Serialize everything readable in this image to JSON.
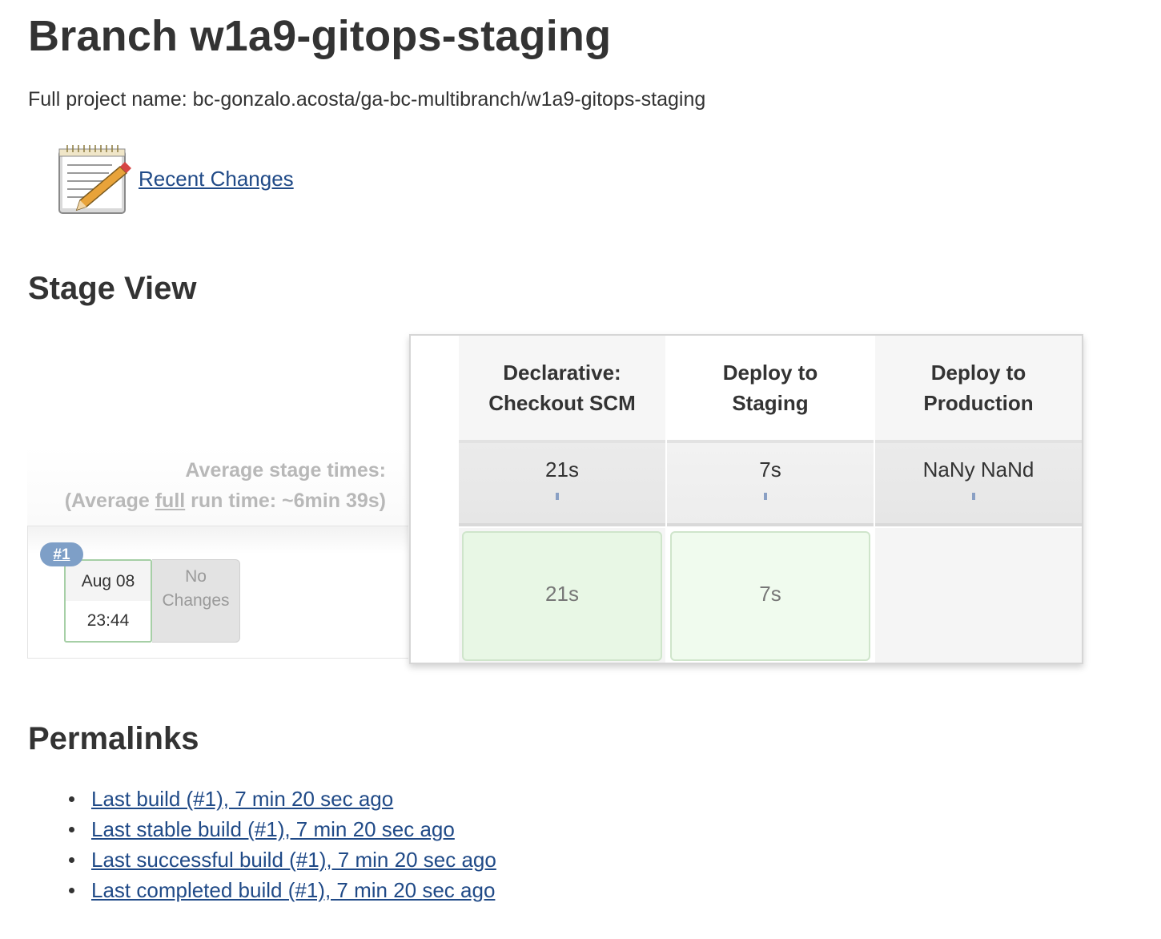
{
  "page": {
    "title": "Branch w1a9-gitops-staging",
    "full_project_name": "Full project name: bc-gonzalo.acosta/ga-bc-multibranch/w1a9-gitops-staging"
  },
  "recent_changes": {
    "label": "Recent Changes",
    "icon": "notepad-pencil-icon"
  },
  "stage_view": {
    "heading": "Stage View",
    "average_label_line1": "Average stage times:",
    "average_label_prefix": "(Average ",
    "average_label_full": "full",
    "average_label_suffix": " run time: ~6min 39s)",
    "stages": [
      {
        "name_line1": "Declarative:",
        "name_line2": "Checkout SCM",
        "average": "21s",
        "run_time": "21s",
        "status": "success"
      },
      {
        "name_line1": "Deploy to",
        "name_line2": "Staging",
        "average": "7s",
        "run_time": "7s",
        "status": "success"
      },
      {
        "name_line1": "Deploy to",
        "name_line2": "Production",
        "average": "NaNy NaNd",
        "run_time": "",
        "status": "not-run"
      }
    ],
    "run": {
      "badge": "#1",
      "date": "Aug 08",
      "time": "23:44",
      "changes_line1": "No",
      "changes_line2": "Changes"
    },
    "colors": {
      "success_cell": "#e8f7e5",
      "badge": "#7e9fc7"
    }
  },
  "permalinks": {
    "heading": "Permalinks",
    "items": [
      "Last build (#1), 7 min 20 sec ago",
      "Last stable build (#1), 7 min 20 sec ago",
      "Last successful build (#1), 7 min 20 sec ago",
      "Last completed build (#1), 7 min 20 sec ago"
    ]
  }
}
